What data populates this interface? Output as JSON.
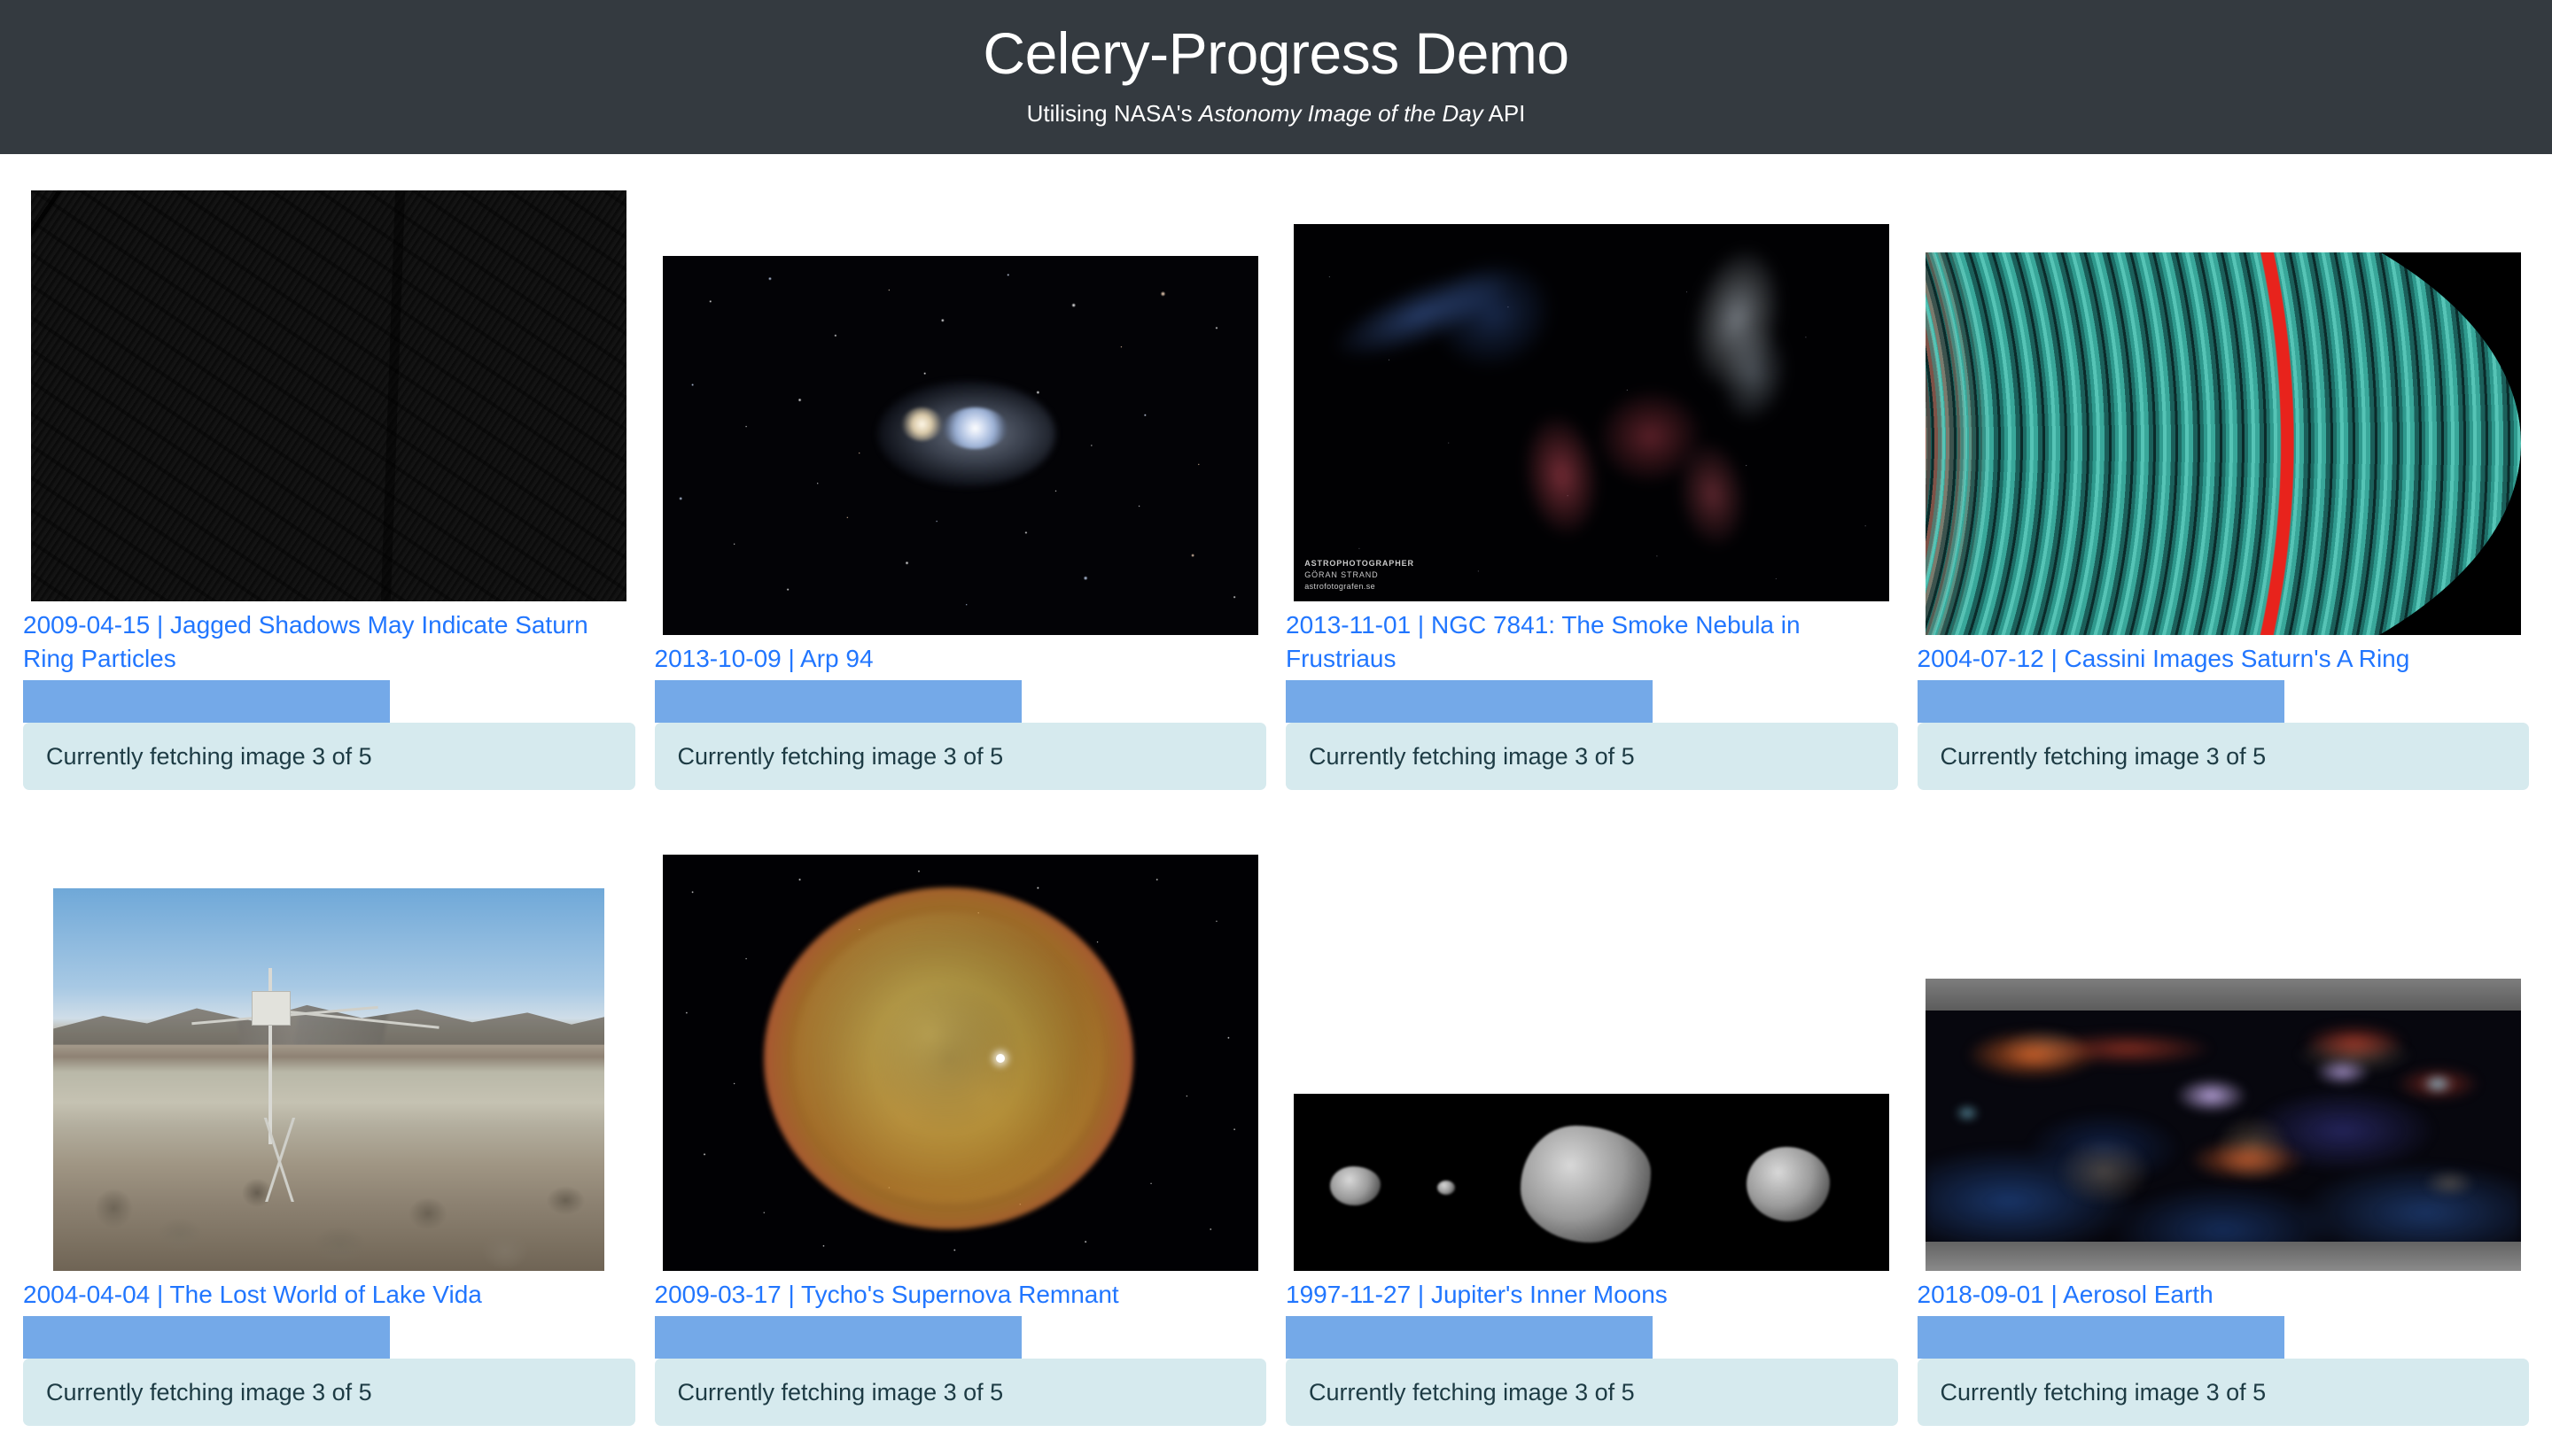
{
  "header": {
    "title": "Celery-Progress Demo",
    "subtitle_prefix": "Utilising NASA's ",
    "subtitle_em": "Astonomy Image of the Day",
    "subtitle_suffix": " API"
  },
  "colors": {
    "header_bg": "#343a40",
    "link": "#2176ff",
    "progress_fill": "#74a9e8",
    "progress_track": "#ffffff",
    "status_bg": "#d6eaee",
    "status_text": "#1d3b44",
    "page_bg": "#ffffff"
  },
  "progress": {
    "percent": 60,
    "current": 3,
    "total": 5
  },
  "image_credit": {
    "line1": "ASTROPHOTOGRAPHER",
    "line2": "GÖRAN STRAND",
    "line3": "astrofotografen.se"
  },
  "cards": [
    {
      "date": "2009-04-15",
      "title": "Jagged Shadows May Indicate Saturn Ring Particles",
      "caption": "2009-04-15 | Jagged Shadows May Indicate Saturn Ring Particles",
      "status": "Currently fetching image 3 of 5",
      "progress_percent": 60,
      "image_alt": "Grayscale close-up of Saturn's rings with a long jagged shadow"
    },
    {
      "date": "2013-10-09",
      "title": "Arp 94",
      "caption": "2013-10-09 | Arp 94",
      "status": "Currently fetching image 3 of 5",
      "progress_percent": 60,
      "image_alt": "Pair of interacting galaxies in a dense starfield"
    },
    {
      "date": "2013-11-01",
      "title": "NGC 7841: The Smoke Nebula in Frustriaus",
      "caption": "2013-11-01 | NGC 7841: The Smoke Nebula in Frustriaus",
      "status": "Currently fetching image 3 of 5",
      "progress_percent": 60,
      "image_alt": "Blue and red smoke-like nebula wisps against black sky"
    },
    {
      "date": "2004-07-12",
      "title": "Cassini Images Saturn's A Ring",
      "caption": "2004-07-12 | Cassini Images Saturn's A Ring",
      "status": "Currently fetching image 3 of 5",
      "progress_percent": 60,
      "image_alt": "False-colour teal and red concentric bands of Saturn's A ring"
    },
    {
      "date": "2004-04-04",
      "title": "The Lost World of Lake Vida",
      "caption": "2004-04-04 | The Lost World of Lake Vida",
      "status": "Currently fetching image 3 of 5",
      "progress_percent": 60,
      "image_alt": "Antarctic field station mast on a rocky desert plain under blue sky"
    },
    {
      "date": "2009-03-17",
      "title": "Tycho's Supernova Remnant",
      "caption": "2009-03-17 | Tycho's Supernova Remnant",
      "status": "Currently fetching image 3 of 5",
      "progress_percent": 60,
      "image_alt": "Golden and purple spherical supernova remnant shell in a starfield"
    },
    {
      "date": "1997-11-27",
      "title": "Jupiter's Inner Moons",
      "caption": "1997-11-27 | Jupiter's Inner Moons",
      "status": "Currently fetching image 3 of 5",
      "progress_percent": 60,
      "image_alt": "Four grayscale irregular inner moons of Jupiter on black"
    },
    {
      "date": "2018-09-01",
      "title": "Aerosol Earth",
      "caption": "2018-09-01 | Aerosol Earth",
      "status": "Currently fetching image 3 of 5",
      "progress_percent": 60,
      "image_alt": "World map visualisation of aerosols in red, blue and purple"
    }
  ]
}
